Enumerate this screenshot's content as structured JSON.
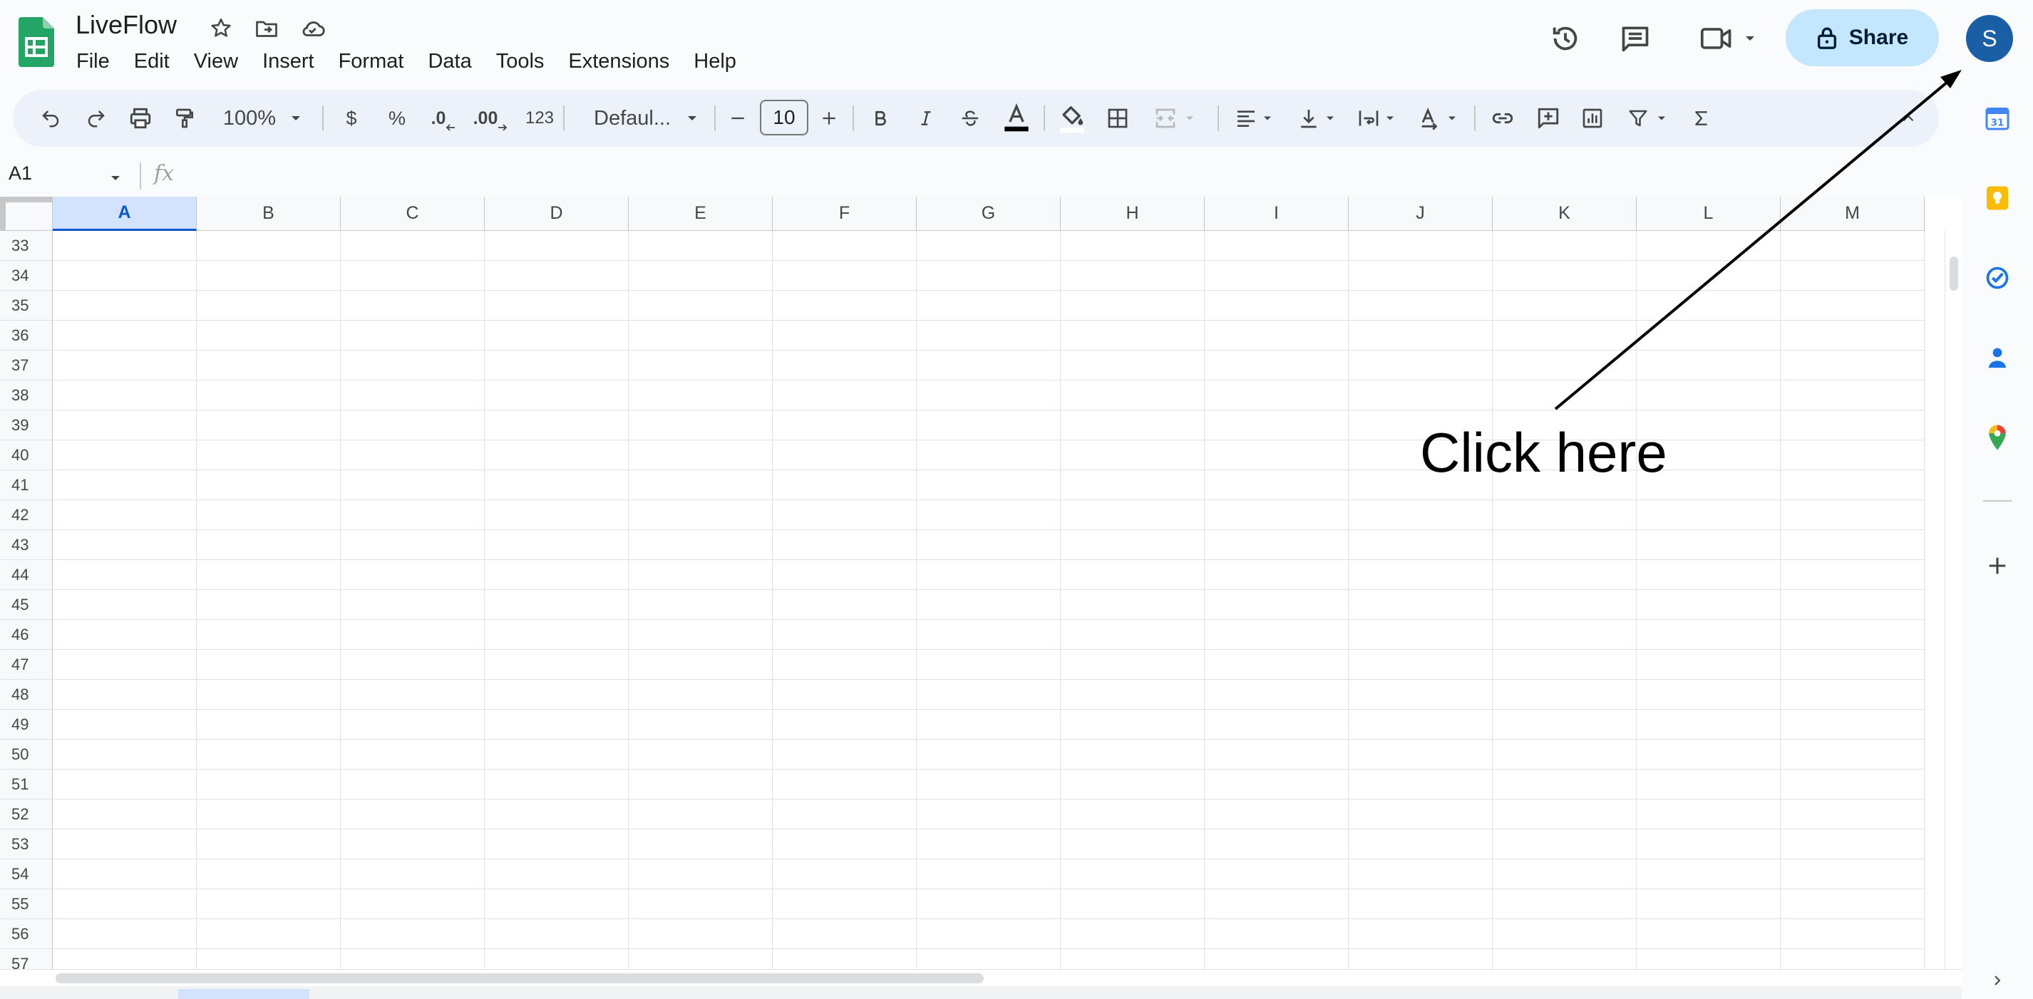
{
  "app": {
    "doc_title": "LiveFlow",
    "menu": [
      "File",
      "Edit",
      "View",
      "Insert",
      "Format",
      "Data",
      "Tools",
      "Extensions",
      "Help"
    ],
    "share_label": "Share",
    "avatar_letter": "S"
  },
  "toolbar": {
    "zoom": "100%",
    "currency": "$",
    "percent": "%",
    "decrease_decimal": ".0",
    "increase_decimal": ".00",
    "number_format": "123",
    "font": "Defaul...",
    "font_size": "10"
  },
  "formula_bar": {
    "cell_ref": "A1",
    "fx": "fx"
  },
  "grid": {
    "columns": [
      "A",
      "B",
      "C",
      "D",
      "E",
      "F",
      "G",
      "H",
      "I",
      "J",
      "K",
      "L",
      "M"
    ],
    "selected_column": "A",
    "rows": [
      "33",
      "34",
      "35",
      "36",
      "37",
      "38",
      "39",
      "40",
      "41",
      "42",
      "43",
      "44",
      "45",
      "46",
      "47",
      "48",
      "49",
      "50",
      "51",
      "52",
      "53",
      "54",
      "55",
      "56",
      "57"
    ]
  },
  "annotation": {
    "text": "Click here"
  },
  "colors": {
    "share_bg": "#c2e7ff",
    "avatar_bg": "#1a5ea6",
    "toolbar_bg": "#edf2fa",
    "selected_header": "#d3e3fd",
    "sheets_green": "#1e8e3e"
  }
}
